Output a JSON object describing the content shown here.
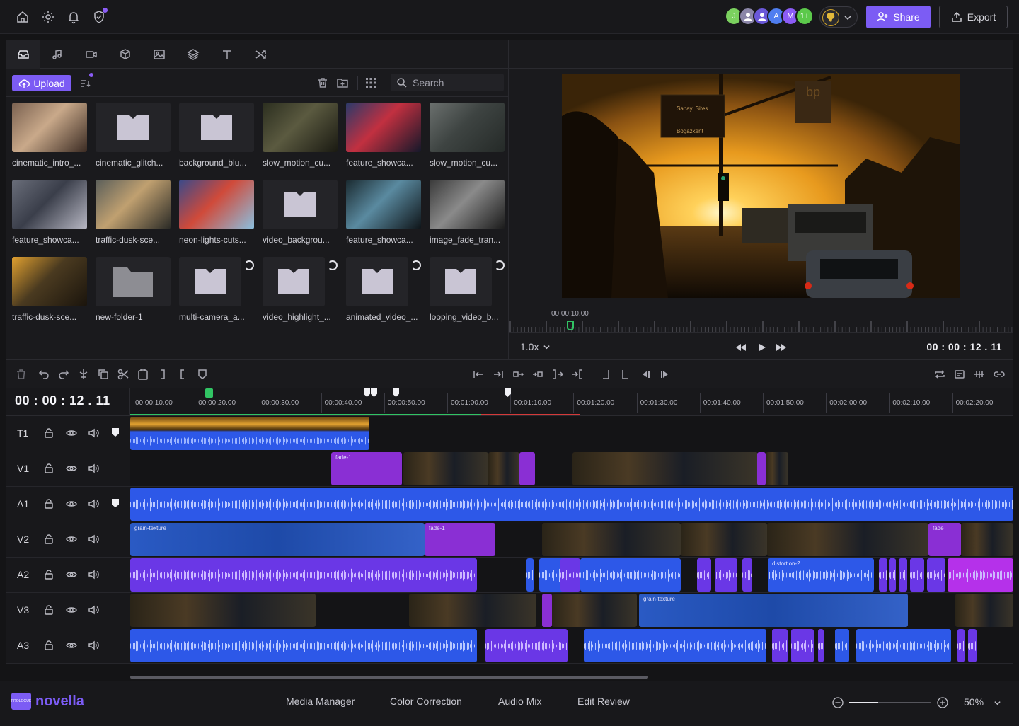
{
  "topbar": {
    "icons": [
      "home-icon",
      "gear-icon",
      "bell-icon",
      "shield-icon"
    ],
    "avatars": [
      {
        "initial": "J",
        "color": "#7bd15f"
      },
      {
        "initial": "",
        "color": "#8b86a8"
      },
      {
        "initial": "",
        "color": "#6a58d8"
      },
      {
        "initial": "A",
        "color": "#4f7ef0"
      },
      {
        "initial": "M",
        "color": "#8b5cf6"
      },
      {
        "initial": "1+",
        "color": "#5cc94b"
      }
    ],
    "share_label": "Share",
    "export_label": "Export"
  },
  "media": {
    "tabs": [
      "folder-icon",
      "music-icon",
      "video-icon",
      "cube-icon",
      "image-icon",
      "layers-icon",
      "text-icon",
      "shuffle-icon"
    ],
    "upload_label": "Upload",
    "search_placeholder": "Search",
    "items": [
      {
        "label": "cinematic_intro_...",
        "kind": "img",
        "palette": [
          "#7a6150",
          "#c9a98a",
          "#3a2a22"
        ]
      },
      {
        "label": "cinematic_glitch...",
        "kind": "ph"
      },
      {
        "label": "background_blu...",
        "kind": "ph"
      },
      {
        "label": "slow_motion_cu...",
        "kind": "img",
        "palette": [
          "#2b2e1f",
          "#5b5a40",
          "#1a1a12"
        ]
      },
      {
        "label": "feature_showca...",
        "kind": "img",
        "palette": [
          "#2a3a6a",
          "#c23040",
          "#14182a"
        ]
      },
      {
        "label": "slow_motion_cu...",
        "kind": "img",
        "palette": [
          "#6b706e",
          "#3e4442",
          "#252a28"
        ]
      },
      {
        "label": "feature_showca...",
        "kind": "img",
        "palette": [
          "#6a6e7a",
          "#3a3e4a",
          "#b8b8c4"
        ]
      },
      {
        "label": "traffic-dusk-sce...",
        "kind": "img",
        "palette": [
          "#5a5e5a",
          "#c0a070",
          "#2a2a26"
        ]
      },
      {
        "label": "neon-lights-cuts...",
        "kind": "img",
        "palette": [
          "#3a4a8a",
          "#d04a3a",
          "#8ac0e0"
        ]
      },
      {
        "label": "video_backgrou...",
        "kind": "ph"
      },
      {
        "label": "feature_showca...",
        "kind": "img",
        "palette": [
          "#1a2a30",
          "#5a8aa0",
          "#0e1418"
        ]
      },
      {
        "label": "image_fade_tran...",
        "kind": "img",
        "palette": [
          "#3a3a3a",
          "#8a8a8a",
          "#1a1a1a"
        ]
      },
      {
        "label": "traffic-dusk-sce...",
        "kind": "img",
        "palette": [
          "#e0a030",
          "#4a3a20",
          "#1a140c"
        ]
      },
      {
        "label": "new-folder-1",
        "kind": "folder"
      },
      {
        "label": "multi-camera_a...",
        "kind": "ph",
        "loading": true
      },
      {
        "label": "video_highlight_...",
        "kind": "ph",
        "loading": true
      },
      {
        "label": "animated_video_...",
        "kind": "ph",
        "loading": true
      },
      {
        "label": "looping_video_b...",
        "kind": "ph",
        "loading": true
      }
    ]
  },
  "preview": {
    "ruler_time": "00:00:10.00",
    "speed": "1.0x",
    "timecode": "00 : 00 : 12 . 11",
    "sign_text_1": "Sanayi Sites",
    "sign_text_2": "Boğazkent",
    "sign_text_3": "bp"
  },
  "timeline": {
    "timecode": "00 : 00 : 12 . 11",
    "ruler_labels": [
      "00:00:10.00",
      "00:00:20.00",
      "00:00:30.00",
      "00:00:40.00",
      "00:00:50.00",
      "00:01:00.00",
      "00:01:10.00",
      "00:01:20.00",
      "00:01:30.00",
      "00:01:40.00",
      "00:01:50.00",
      "00:02:00.00",
      "00:02:10.00",
      "00:02:20.00"
    ],
    "tracks": [
      "T1",
      "V1",
      "A1",
      "V2",
      "A2",
      "V3",
      "A3"
    ],
    "clip_labels": {
      "fade1_v1": "fade-1",
      "grain_v2": "grain-texture",
      "fade1_v2": "fade-1",
      "fade_v2_end": "fade",
      "distortion": "distortion-2",
      "grain_v3": "grain-texture"
    }
  },
  "bottombar": {
    "logo_mark": "PROLOGUE",
    "logo_text": "novella",
    "nav": [
      "Media Manager",
      "Color Correction",
      "Audio Mix",
      "Edit Review"
    ],
    "zoom_level": "50%",
    "zoom_fraction": 0.36
  }
}
